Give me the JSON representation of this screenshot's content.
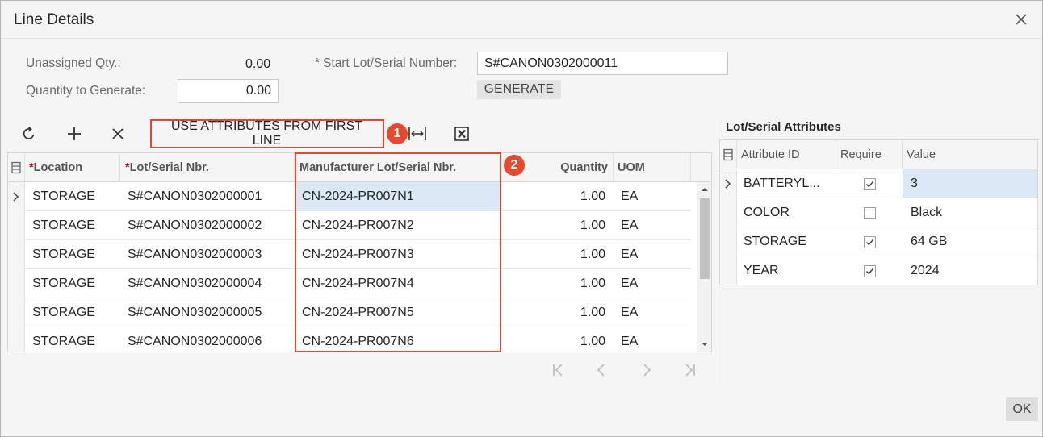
{
  "dialog": {
    "title": "Line Details",
    "ok_label": "OK"
  },
  "form": {
    "unassigned_qty_label": "Unassigned Qty.:",
    "unassigned_qty_value": "0.00",
    "quantity_to_generate_label": "Quantity to Generate:",
    "quantity_to_generate_value": "0.00",
    "start_lot_label": "Start Lot/Serial Number:",
    "start_lot_required": "*",
    "start_lot_value": "S#CANON0302000011",
    "generate_label": "GENERATE"
  },
  "toolbar": {
    "use_attributes_label": "USE ATTRIBUTES FROM FIRST LINE",
    "callout_1": "1",
    "callout_2": "2"
  },
  "grid": {
    "columns": [
      {
        "label": "Location",
        "required": "*"
      },
      {
        "label": "Lot/Serial Nbr.",
        "required": "*"
      },
      {
        "label": "Manufacturer Lot/Serial Nbr.",
        "required": ""
      },
      {
        "label": "Quantity",
        "required": ""
      },
      {
        "label": "UOM",
        "required": ""
      }
    ],
    "rows": [
      {
        "location": "STORAGE",
        "lot": "S#CANON0302000001",
        "mfr_lot": "CN-2024-PR007N1",
        "qty": "1.00",
        "uom": "EA"
      },
      {
        "location": "STORAGE",
        "lot": "S#CANON0302000002",
        "mfr_lot": "CN-2024-PR007N2",
        "qty": "1.00",
        "uom": "EA"
      },
      {
        "location": "STORAGE",
        "lot": "S#CANON0302000003",
        "mfr_lot": "CN-2024-PR007N3",
        "qty": "1.00",
        "uom": "EA"
      },
      {
        "location": "STORAGE",
        "lot": "S#CANON0302000004",
        "mfr_lot": "CN-2024-PR007N4",
        "qty": "1.00",
        "uom": "EA"
      },
      {
        "location": "STORAGE",
        "lot": "S#CANON0302000005",
        "mfr_lot": "CN-2024-PR007N5",
        "qty": "1.00",
        "uom": "EA"
      },
      {
        "location": "STORAGE",
        "lot": "S#CANON0302000006",
        "mfr_lot": "CN-2024-PR007N6",
        "qty": "1.00",
        "uom": "EA"
      }
    ]
  },
  "attributes": {
    "title": "Lot/Serial Attributes",
    "columns": [
      "Attribute ID",
      "Require",
      "Value"
    ],
    "rows": [
      {
        "id": "BATTERYL...",
        "required": true,
        "value": "3"
      },
      {
        "id": "COLOR",
        "required": false,
        "value": "Black"
      },
      {
        "id": "STORAGE",
        "required": true,
        "value": "64 GB"
      },
      {
        "id": "YEAR",
        "required": true,
        "value": "2024"
      }
    ]
  },
  "colors": {
    "callout": "#e8492e",
    "highlight": "#e04a30",
    "selected_row": "#dbe9f7",
    "required": "#b5131c"
  }
}
